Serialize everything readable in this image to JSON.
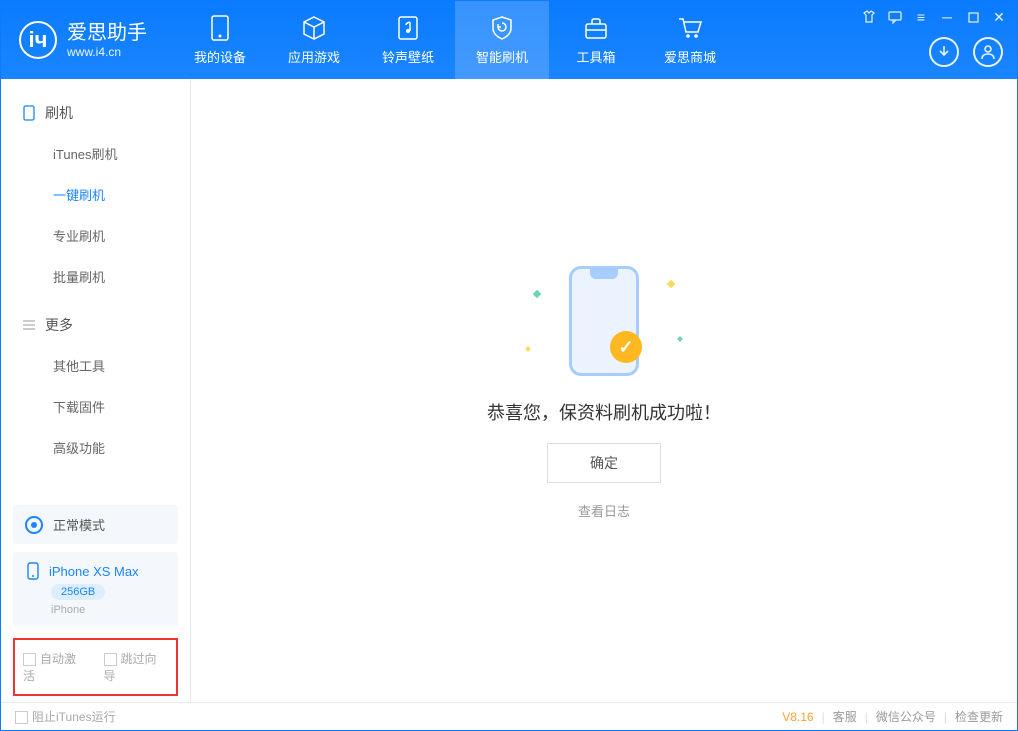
{
  "app": {
    "name": "爱思助手",
    "url": "www.i4.cn"
  },
  "tabs": [
    {
      "label": "我的设备",
      "icon": "device"
    },
    {
      "label": "应用游戏",
      "icon": "cube"
    },
    {
      "label": "铃声壁纸",
      "icon": "music"
    },
    {
      "label": "智能刷机",
      "icon": "shield",
      "active": true
    },
    {
      "label": "工具箱",
      "icon": "toolbox"
    },
    {
      "label": "爱思商城",
      "icon": "cart"
    }
  ],
  "sidebar": {
    "groups": [
      {
        "title": "刷机",
        "icon": "phone",
        "items": [
          {
            "label": "iTunes刷机"
          },
          {
            "label": "一键刷机",
            "selected": true
          },
          {
            "label": "专业刷机"
          },
          {
            "label": "批量刷机"
          }
        ]
      },
      {
        "title": "更多",
        "icon": "menu",
        "items": [
          {
            "label": "其他工具"
          },
          {
            "label": "下载固件"
          },
          {
            "label": "高级功能"
          }
        ]
      }
    ],
    "mode": {
      "label": "正常模式"
    },
    "device": {
      "name": "iPhone XS Max",
      "storage": "256GB",
      "type": "iPhone"
    },
    "checks": {
      "auto_activate": "自动激活",
      "skip_guide": "跳过向导"
    }
  },
  "main": {
    "message": "恭喜您，保资料刷机成功啦！",
    "ok": "确定",
    "view_log": "查看日志"
  },
  "footer": {
    "block_itunes": "阻止iTunes运行",
    "version": "V8.16",
    "links": [
      "客服",
      "微信公众号",
      "检查更新"
    ]
  }
}
